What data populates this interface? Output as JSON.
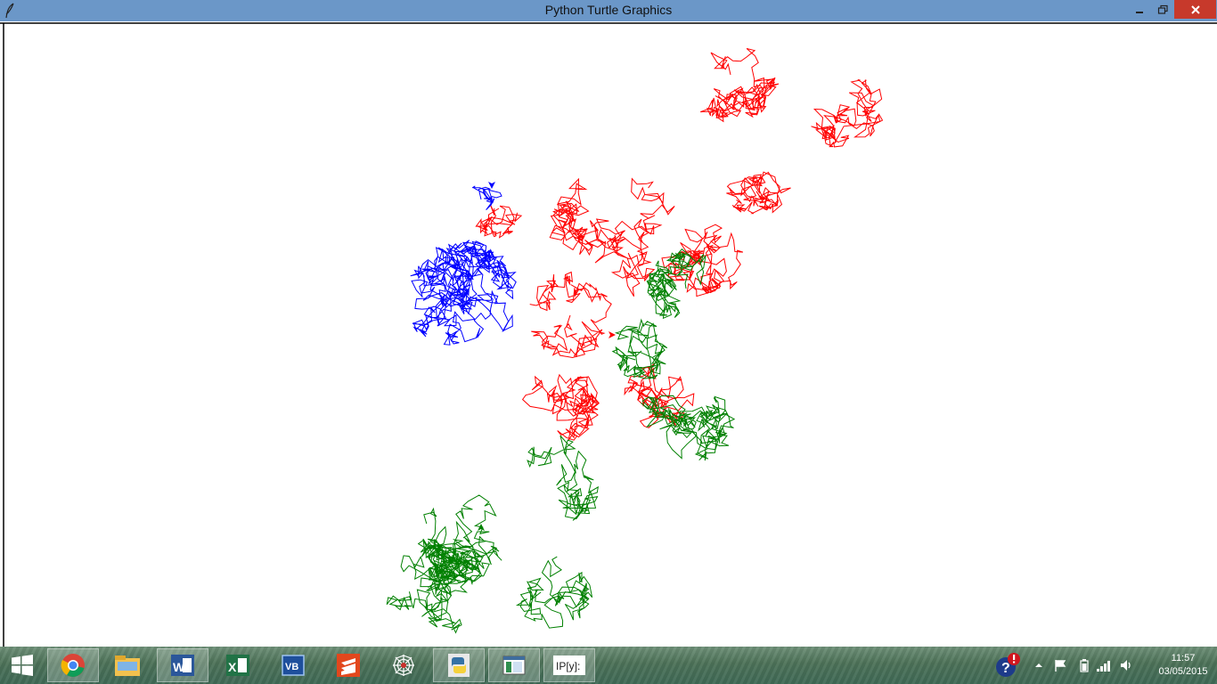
{
  "window": {
    "title": "Python Turtle Graphics",
    "buttons": {
      "minimize": "minimize",
      "restore": "restore",
      "close": "close"
    }
  },
  "canvas": {
    "background": "#ffffff",
    "walks": [
      {
        "color": "#ff0000"
      },
      {
        "color": "#0000ff"
      },
      {
        "color": "#008000"
      }
    ]
  },
  "taskbar": {
    "apps": [
      {
        "icon": "chrome-icon"
      },
      {
        "icon": "file-explorer-icon"
      },
      {
        "icon": "word-icon"
      },
      {
        "icon": "excel-icon"
      },
      {
        "icon": "visual-basic-icon"
      },
      {
        "icon": "sublime-icon"
      },
      {
        "icon": "spider-web-icon"
      },
      {
        "icon": "python-icon"
      },
      {
        "icon": "window-icon"
      },
      {
        "icon": "ipython-icon"
      }
    ],
    "word_label": "W",
    "excel_label": "X",
    "vb_label": "VB",
    "ipython_label": "IP[y]:",
    "clock": {
      "time": "11:57",
      "date": "03/05/2015"
    }
  }
}
